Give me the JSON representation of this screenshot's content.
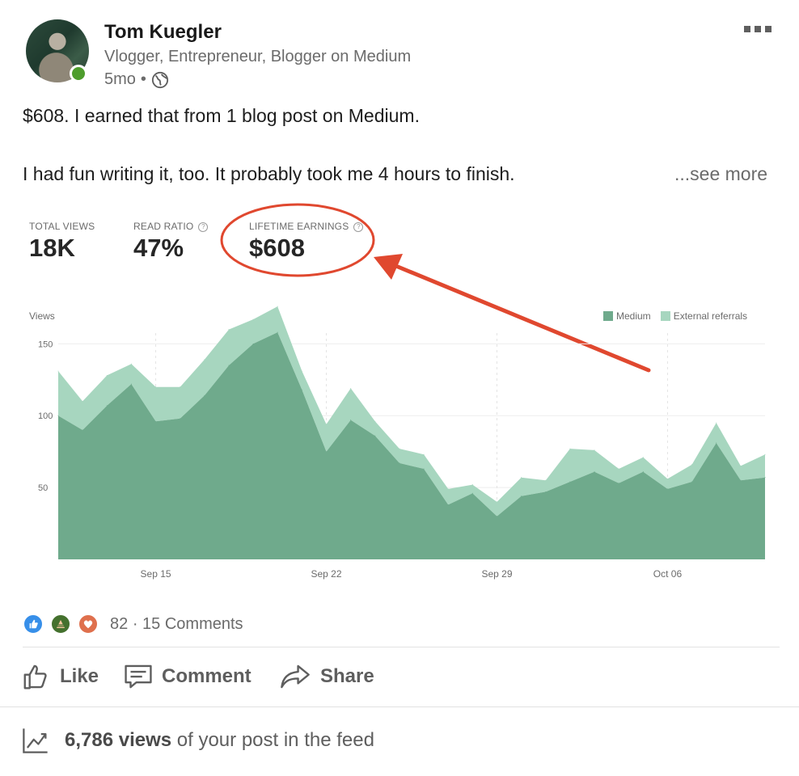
{
  "author": {
    "name": "Tom Kuegler",
    "headline": "Vlogger, Entrepreneur, Blogger on Medium",
    "time": "5mo",
    "separator": "•"
  },
  "post": {
    "line1": "$608. I earned that from 1 blog post on Medium.",
    "line2": "I had fun writing it, too. It probably took me 4 hours to finish.",
    "see_more": "...see more"
  },
  "stats": [
    {
      "label": "TOTAL VIEWS",
      "value": "18K"
    },
    {
      "label": "READ RATIO",
      "value": "47%"
    },
    {
      "label": "LIFETIME EARNINGS",
      "value": "$608"
    }
  ],
  "chart_data": {
    "type": "area",
    "ylabel": "Views",
    "y_ticks": [
      "150",
      "100",
      "50"
    ],
    "ylim": [
      0,
      180
    ],
    "x_tick_labels": [
      "Sep 15",
      "Sep 22",
      "Sep 29",
      "Oct 06"
    ],
    "x_tick_index": [
      4,
      11,
      18,
      25
    ],
    "stacked": true,
    "legend_position": "top-right",
    "series": [
      {
        "name": "Medium",
        "color": "#6faa8c",
        "values": [
          100,
          90,
          107,
          122,
          96,
          98,
          114,
          135,
          150,
          158,
          118,
          75,
          97,
          86,
          67,
          63,
          38,
          46,
          30,
          44,
          47,
          54,
          61,
          53,
          61,
          49,
          54,
          81,
          55,
          57
        ]
      },
      {
        "name": "External referrals",
        "color": "#a7d6bf",
        "values": [
          31,
          20,
          21,
          14,
          24,
          22,
          25,
          25,
          17,
          18,
          13,
          19,
          22,
          10,
          10,
          10,
          11,
          6,
          10,
          13,
          8,
          23,
          15,
          10,
          10,
          7,
          12,
          14,
          10,
          16
        ]
      }
    ]
  },
  "social": {
    "reaction_count": "82",
    "dot": "·",
    "comments": "15 Comments"
  },
  "actions": {
    "like": "Like",
    "comment": "Comment",
    "share": "Share"
  },
  "views": {
    "count": "6,786 views",
    "suffix": " of your post in the feed"
  },
  "colors": {
    "annotation_red": "#e0482f",
    "presence_green": "#4e9d2d"
  }
}
